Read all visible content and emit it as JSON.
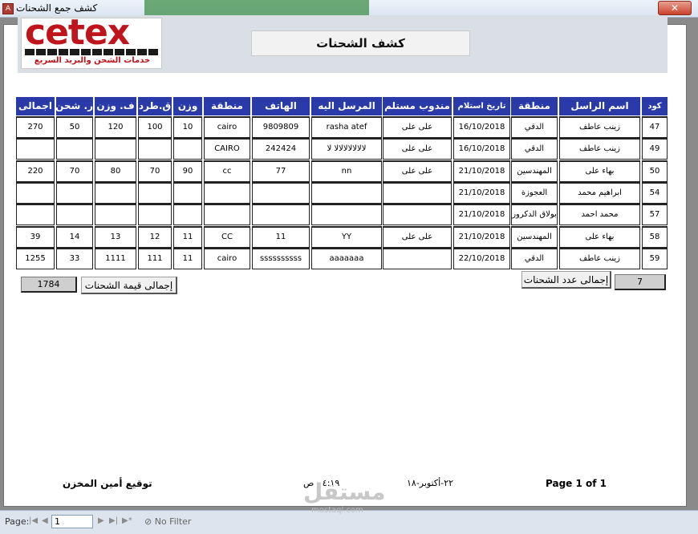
{
  "window": {
    "title": "كشف جمع الشحنات",
    "close_label": "✕"
  },
  "logo": {
    "brand": "cetex",
    "tagline": "خدمات الشحن والبريد السريع"
  },
  "report": {
    "title": "كشف الشحنات"
  },
  "table": {
    "columns": [
      "كود",
      "اسم الراسل",
      "منطقة",
      "تاريخ استلام",
      "مندوب مستلم",
      "المرسل اليه",
      "الهاتف",
      "منطقة",
      "وزن",
      "ق.طرد",
      "ف. وزن",
      "ر. شحن",
      "اجمالى"
    ],
    "rows": [
      [
        "47",
        "زينب عاطف",
        "الدقي",
        "16/10/2018",
        "على على",
        "rasha atef",
        "9809809",
        "cairo",
        "10",
        "100",
        "120",
        "50",
        "270"
      ],
      [
        "49",
        "زينب عاطف",
        "الدقي",
        "16/10/2018",
        "على على",
        "لالالالالالالا لا",
        "242424",
        "CAIRO",
        "",
        "",
        "",
        "",
        ""
      ],
      [
        "50",
        "بهاء على",
        "المهندسين",
        "21/10/2018",
        "على على",
        "nn",
        "77",
        "cc",
        "90",
        "70",
        "80",
        "70",
        "220"
      ],
      [
        "54",
        "ابراهيم محمد",
        "العجوزة",
        "21/10/2018",
        "",
        "",
        "",
        "",
        "",
        "",
        "",
        "",
        ""
      ],
      [
        "57",
        "محمد احمد",
        "بولاق الدكرور",
        "21/10/2018",
        "",
        "",
        "",
        "",
        "",
        "",
        "",
        "",
        ""
      ],
      [
        "58",
        "بهاء على",
        "المهندسين",
        "21/10/2018",
        "على على",
        "YY",
        "11",
        "CC",
        "11",
        "12",
        "13",
        "14",
        "39"
      ],
      [
        "59",
        "زينب عاطف",
        "الدقي",
        "22/10/2018",
        "",
        "aaaaaaa",
        "ssssssssss",
        "cairo",
        "11",
        "111",
        "1111",
        "33",
        "1255"
      ]
    ]
  },
  "totals": {
    "count_label": "إجمالى عدد الشحنات",
    "count_value": "7",
    "value_label": "إجمالى قيمة الشحنات",
    "value_value": "1784"
  },
  "footer": {
    "signature": "توقيع أمين المخزن",
    "time": "٤:١٩ . ص",
    "date": "٢٢-أكتوبر-١٨",
    "page": "Page 1 of 1"
  },
  "statusbar": {
    "page_label": "Page:",
    "page_value": "1",
    "filter_label": "No Filter",
    "watermark": "مستقل",
    "watermark_url": "mostaql.com"
  }
}
